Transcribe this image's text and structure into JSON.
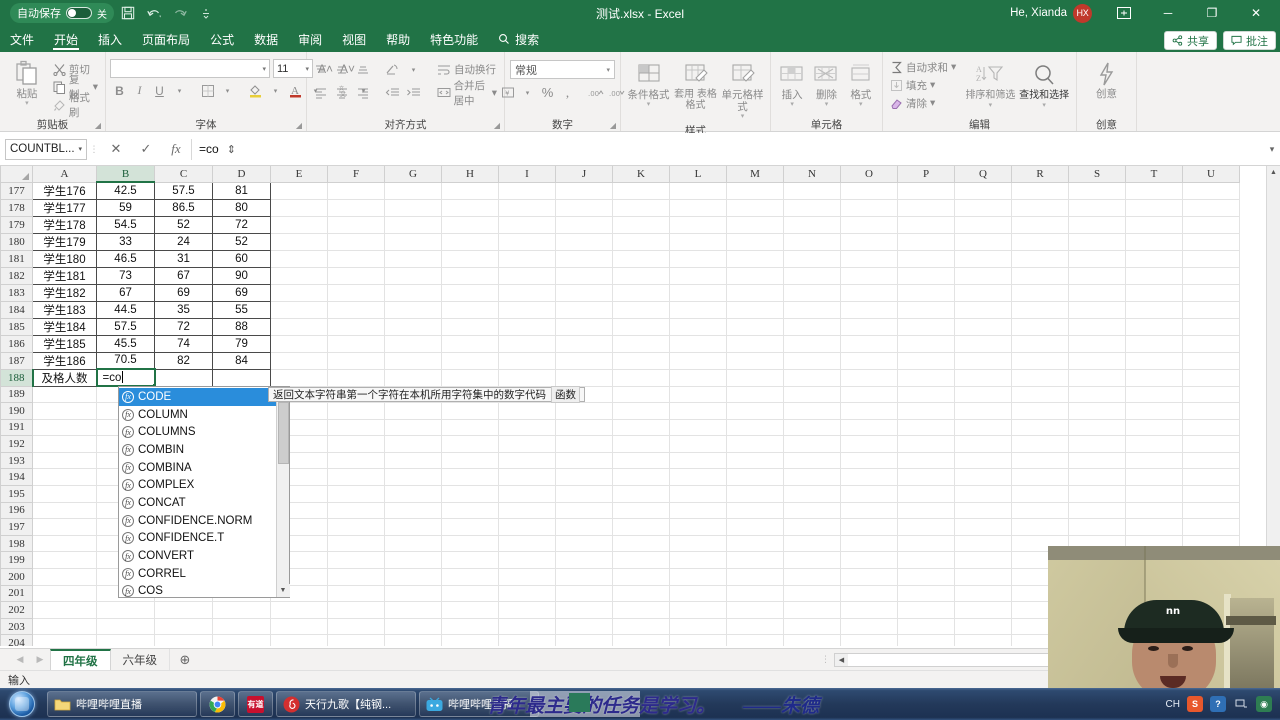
{
  "titlebar": {
    "autosave_label": "自动保存",
    "autosave_state": "关",
    "save_icon": "save-icon",
    "undo_icon": "undo-icon",
    "redo_icon": "redo-icon",
    "more_icon": "more-commands-icon",
    "document_title": "测试.xlsx  -  Excel",
    "user_name": "He, Xianda",
    "user_initials": "HX",
    "ribbon_display_icon": "ribbon-display-options-icon",
    "minimize": "─",
    "maximize": "❐",
    "close": "✕"
  },
  "tabs": [
    {
      "label": "文件",
      "active": false
    },
    {
      "label": "开始",
      "active": true
    },
    {
      "label": "插入",
      "active": false
    },
    {
      "label": "页面布局",
      "active": false
    },
    {
      "label": "公式",
      "active": false
    },
    {
      "label": "数据",
      "active": false
    },
    {
      "label": "审阅",
      "active": false
    },
    {
      "label": "视图",
      "active": false
    },
    {
      "label": "帮助",
      "active": false
    },
    {
      "label": "特色功能",
      "active": false
    }
  ],
  "search": {
    "label": "搜索",
    "icon": "search-icon"
  },
  "share": {
    "share_label": "共享",
    "share_icon": "share-icon",
    "comment_label": "批注",
    "comment_icon": "comment-icon"
  },
  "ribbon": {
    "groups": [
      {
        "title": "剪贴板",
        "paste_label": "粘贴",
        "items": [
          {
            "label": "剪切",
            "icon": "scissors-icon"
          },
          {
            "label": "复制",
            "icon": "copy-icon"
          },
          {
            "label": "格式刷",
            "icon": "format-painter-icon"
          }
        ]
      },
      {
        "title": "字体",
        "font_name": "",
        "font_size": "11",
        "grow_font": "A˄",
        "shrink_font": "A˅",
        "bold": "B",
        "italic": "I",
        "underline": "U",
        "border_icon": "borders-icon",
        "fill_icon": "fill-color-icon",
        "fontcolor_icon": "font-color-icon",
        "phonetic_icon": "phonetic-guide-icon"
      },
      {
        "title": "对齐方式",
        "wrap_label": "自动换行",
        "merge_label": "合并后居中",
        "orientation_icon": "orientation-icon"
      },
      {
        "title": "数字",
        "format_value": "常规",
        "currency_icon": "accounting-format-icon",
        "percent_icon": "%",
        "comma_icon": "′",
        "inc_dec_icon": "increase-decimal-icon",
        "dec_dec_icon": "decrease-decimal-icon"
      },
      {
        "title": "样式",
        "items": [
          {
            "label": "条件格式",
            "icon": "conditional-formatting-icon"
          },
          {
            "label": "套用\n表格格式",
            "icon": "format-as-table-icon"
          },
          {
            "label": "单元格样式",
            "icon": "cell-styles-icon"
          }
        ]
      },
      {
        "title": "单元格",
        "items": [
          {
            "label": "插入",
            "icon": "insert-cells-icon"
          },
          {
            "label": "删除",
            "icon": "delete-cells-icon"
          },
          {
            "label": "格式",
            "icon": "format-cells-icon"
          }
        ]
      },
      {
        "title": "编辑",
        "autosum_label": "自动求和",
        "fill_label": "填充",
        "clear_label": "清除",
        "sort_label": "排序和筛选",
        "find_label": "查找和选择"
      },
      {
        "title": "创意",
        "ideas_label": "创意",
        "ideas_icon": "ideas-lightning-icon"
      }
    ]
  },
  "formulabar": {
    "name_box": "COUNTBL...",
    "cancel_icon": "cancel-icon",
    "enter_icon": "confirm-icon",
    "fx_icon": "insert-function-icon",
    "formula_text": "=co",
    "expand_icon": "expand-formula-bar-icon"
  },
  "grid": {
    "columns": [
      "A",
      "B",
      "C",
      "D",
      "E",
      "F",
      "G",
      "H",
      "I",
      "J",
      "K",
      "L",
      "M",
      "N",
      "O",
      "P",
      "Q",
      "R",
      "S",
      "T",
      "U"
    ],
    "selected_column": "B",
    "selected_row": 188,
    "rows": [
      {
        "n": 177,
        "a": "学生176",
        "b": "42.5",
        "c": "57.5",
        "d": "81"
      },
      {
        "n": 178,
        "a": "学生177",
        "b": "59",
        "c": "86.5",
        "d": "80"
      },
      {
        "n": 179,
        "a": "学生178",
        "b": "54.5",
        "c": "52",
        "d": "72"
      },
      {
        "n": 180,
        "a": "学生179",
        "b": "33",
        "c": "24",
        "d": "52"
      },
      {
        "n": 181,
        "a": "学生180",
        "b": "46.5",
        "c": "31",
        "d": "60"
      },
      {
        "n": 182,
        "a": "学生181",
        "b": "73",
        "c": "67",
        "d": "90"
      },
      {
        "n": 183,
        "a": "学生182",
        "b": "67",
        "c": "69",
        "d": "69"
      },
      {
        "n": 184,
        "a": "学生183",
        "b": "44.5",
        "c": "35",
        "d": "55"
      },
      {
        "n": 185,
        "a": "学生184",
        "b": "57.5",
        "c": "72",
        "d": "88"
      },
      {
        "n": 186,
        "a": "学生185",
        "b": "45.5",
        "c": "74",
        "d": "79"
      },
      {
        "n": 187,
        "a": "学生186",
        "b": "70.5",
        "c": "82",
        "d": "84"
      },
      {
        "n": 188,
        "a": "及格人数",
        "b": "=co",
        "c": "",
        "d": "",
        "editing": true
      },
      {
        "n": 189,
        "a": "",
        "b": "",
        "c": "",
        "d": ""
      },
      {
        "n": 190,
        "a": "",
        "b": "",
        "c": "",
        "d": ""
      },
      {
        "n": 191,
        "a": "",
        "b": "",
        "c": "",
        "d": ""
      },
      {
        "n": 192,
        "a": "",
        "b": "",
        "c": "",
        "d": ""
      },
      {
        "n": 193,
        "a": "",
        "b": "",
        "c": "",
        "d": ""
      },
      {
        "n": 194,
        "a": "",
        "b": "",
        "c": "",
        "d": ""
      },
      {
        "n": 195,
        "a": "",
        "b": "",
        "c": "",
        "d": ""
      },
      {
        "n": 196,
        "a": "",
        "b": "",
        "c": "",
        "d": ""
      },
      {
        "n": 197,
        "a": "",
        "b": "",
        "c": "",
        "d": ""
      },
      {
        "n": 198,
        "a": "",
        "b": "",
        "c": "",
        "d": ""
      },
      {
        "n": 199,
        "a": "",
        "b": "",
        "c": "",
        "d": ""
      },
      {
        "n": 200,
        "a": "",
        "b": "",
        "c": "",
        "d": ""
      },
      {
        "n": 201,
        "a": "",
        "b": "",
        "c": "",
        "d": ""
      },
      {
        "n": 202,
        "a": "",
        "b": "",
        "c": "",
        "d": ""
      },
      {
        "n": 203,
        "a": "",
        "b": "",
        "c": "",
        "d": ""
      },
      {
        "n": 204,
        "a": "",
        "b": "",
        "c": "",
        "d": ""
      }
    ]
  },
  "autocomplete": {
    "items": [
      {
        "label": "CODE",
        "selected": true
      },
      {
        "label": "COLUMN",
        "selected": false
      },
      {
        "label": "COLUMNS",
        "selected": false
      },
      {
        "label": "COMBIN",
        "selected": false
      },
      {
        "label": "COMBINA",
        "selected": false
      },
      {
        "label": "COMPLEX",
        "selected": false
      },
      {
        "label": "CONCAT",
        "selected": false
      },
      {
        "label": "CONFIDENCE.NORM",
        "selected": false
      },
      {
        "label": "CONFIDENCE.T",
        "selected": false
      },
      {
        "label": "CONVERT",
        "selected": false
      },
      {
        "label": "CORREL",
        "selected": false
      },
      {
        "label": "COS",
        "selected": false
      }
    ],
    "tooltip_text": "返回文本字符串第一个字符在本机所用字符集中的数字代码",
    "tooltip_tag": "函数"
  },
  "sheetbar": {
    "nav_prev": "◀",
    "nav_next": "▶",
    "sheets": [
      {
        "label": "四年级",
        "active": true
      },
      {
        "label": "六年级",
        "active": false
      }
    ],
    "add_sheet": "⊕"
  },
  "statusbar": {
    "mode": "输入"
  },
  "taskbar": {
    "start_icon": "windows-start-orb-icon",
    "items": [
      {
        "label": "哔哩哔哩直播",
        "icon": "folder-icon"
      },
      {
        "label": "",
        "icon": "chrome-icon"
      },
      {
        "label": "",
        "icon": "youdao-icon"
      },
      {
        "label": "天行九歌【纯钢...",
        "icon": "netease-music-icon"
      },
      {
        "label": "哔哩哔哩直播",
        "icon": "bilibili-live-icon"
      }
    ],
    "tray": [
      "CH",
      "sogou-input-icon",
      "help-icon",
      "network-icon",
      "show-desktop-icon"
    ]
  },
  "desktop_quote": {
    "text": "青年最主要的任务是学习。",
    "author": "——朱德"
  }
}
